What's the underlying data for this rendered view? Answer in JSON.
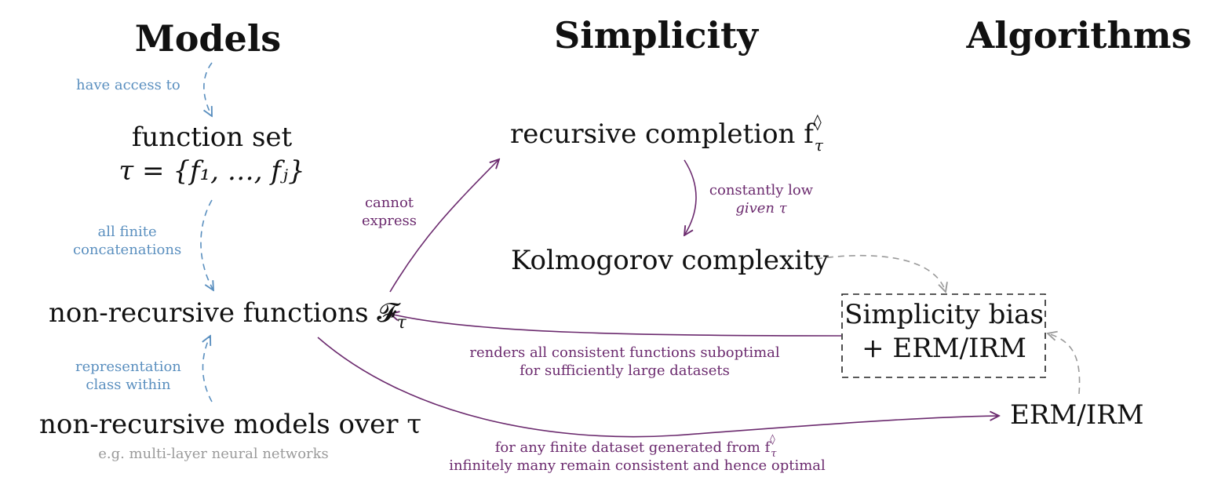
{
  "headers": {
    "models": "Models",
    "simplicity": "Simplicity",
    "algorithms": "Algorithms"
  },
  "nodes": {
    "function_set_line1": "function set",
    "function_set_line2": "τ = {f₁, …, fⱼ}",
    "non_recursive_functions": "non-recursive functions 𝓕",
    "non_recursive_functions_sub": "τ",
    "non_recursive_models": "non-recursive models over τ",
    "models_example": "e.g. multi-layer neural networks",
    "recursive_completion": "recursive completion f",
    "recursive_completion_sup": "◊",
    "recursive_completion_sub": "τ",
    "kolmogorov": "Kolmogorov complexity",
    "simplicity_bias_line1": "Simplicity bias",
    "simplicity_bias_line2": "+ ERM/IRM",
    "erm_irm": "ERM/IRM"
  },
  "edge_labels": {
    "have_access_to": "have access to",
    "all_finite_1": "all finite",
    "all_finite_2": "concatenations",
    "representation_1": "representation",
    "representation_2": "class within",
    "cannot_1": "cannot",
    "cannot_2": "express",
    "constantly_1": "constantly low",
    "constantly_2": "given τ",
    "renders_1": "renders all consistent functions suboptimal",
    "renders_2": "for sufficiently large datasets",
    "finite_1": "for any finite dataset generated from f",
    "finite_1_sup": "◊",
    "finite_1_sub": "τ",
    "finite_2": "infinitely many remain consistent and hence optimal"
  },
  "colors": {
    "blue": "#5a8fbf",
    "purple": "#6b2a6e",
    "gray": "#9a9a9a",
    "black": "#111111"
  }
}
